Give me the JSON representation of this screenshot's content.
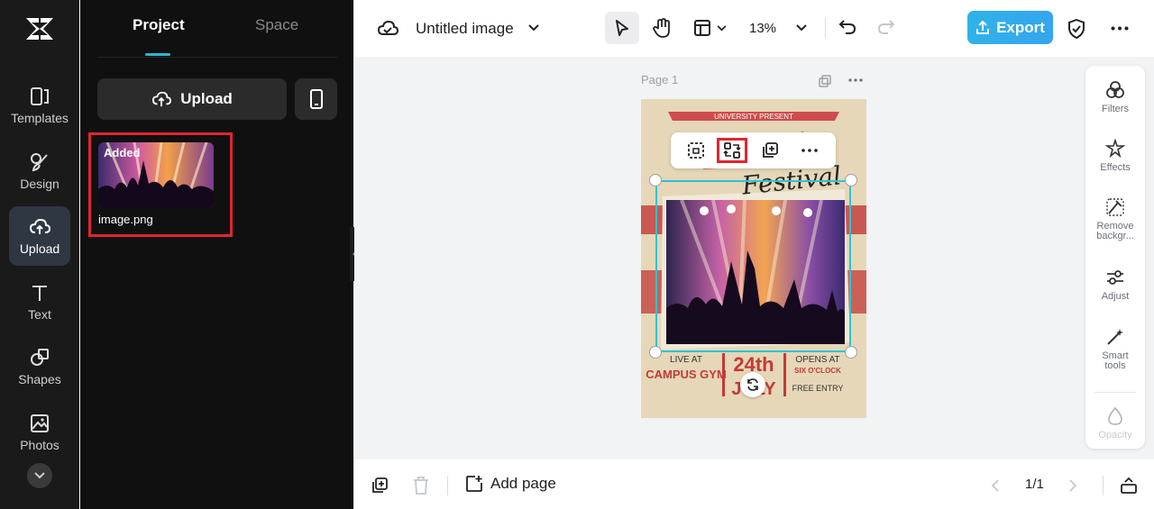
{
  "nav": {
    "items": [
      {
        "label": "Templates",
        "icon": "templates-icon"
      },
      {
        "label": "Design",
        "icon": "design-icon"
      },
      {
        "label": "Upload",
        "icon": "upload-cloud-icon",
        "active": true
      },
      {
        "label": "Text",
        "icon": "text-icon"
      },
      {
        "label": "Shapes",
        "icon": "shapes-icon"
      },
      {
        "label": "Photos",
        "icon": "photos-icon"
      }
    ]
  },
  "panel": {
    "tabs": [
      "Project",
      "Space"
    ],
    "upload_label": "Upload",
    "asset": {
      "badge": "Added",
      "filename": "image.png"
    }
  },
  "header": {
    "title": "Untitled image",
    "zoom": "13%",
    "export_label": "Export"
  },
  "canvas": {
    "page_label": "Page 1",
    "poster": {
      "top": "UNIVERSITY PRESENT",
      "script": "Festival",
      "live_at": "LIVE AT",
      "venue": "CAMPUS GYM",
      "date_day": "24th",
      "date_month": "JULY",
      "opens_at": "OPENS AT",
      "time": "SIX O'CLOCK",
      "entry": "FREE ENTRY"
    }
  },
  "right_panel": {
    "items": [
      "Filters",
      "Effects",
      "Remove backgr...",
      "Adjust",
      "Smart tools",
      "Opacity"
    ]
  },
  "footer": {
    "add_page_label": "Add page",
    "page_count": "1/1"
  },
  "colors": {
    "accent": "#2ab7cf",
    "export": "#35a5f0",
    "highlight": "#e0252f",
    "selection": "#2bc4d4"
  }
}
